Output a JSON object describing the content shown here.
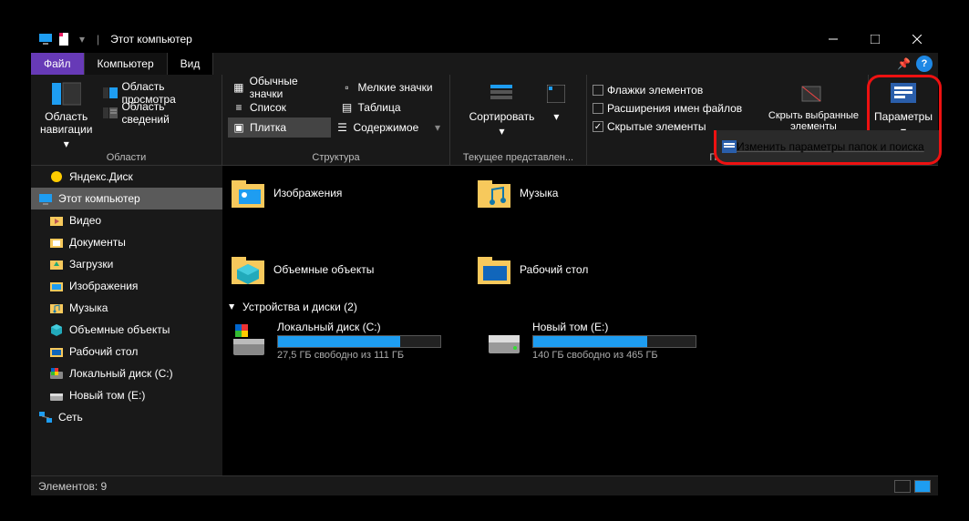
{
  "window": {
    "title": "Этот компьютер"
  },
  "tabs": {
    "file": "Файл",
    "computer": "Компьютер",
    "view": "Вид"
  },
  "ribbon": {
    "areas": {
      "nav": "Область\nнавигации",
      "preview": "Область просмотра",
      "details": "Область сведений",
      "label": "Области"
    },
    "layout": {
      "large": "Обычные значки",
      "small": "Мелкие значки",
      "list": "Список",
      "table": "Таблица",
      "tile": "Плитка",
      "content": "Содержимое",
      "label": "Структура"
    },
    "current": {
      "sort": "Сортировать",
      "label": "Текущее представлен..."
    },
    "show": {
      "cbx_flags": "Флажки элементов",
      "cbx_ext": "Расширения имен файлов",
      "cbx_hidden": "Скрытые элементы",
      "hide": "Скрыть выбранные\nэлементы",
      "label": "Показ..."
    },
    "options": {
      "btn": "Параметры",
      "popup": "Изменить параметры папок и поиска"
    }
  },
  "sidebar": {
    "items": [
      {
        "label": "Яндекс.Диск",
        "icon": "yadisk"
      },
      {
        "label": "Этот компьютер",
        "icon": "pc",
        "selected": true,
        "root": true
      },
      {
        "label": "Видео",
        "icon": "video"
      },
      {
        "label": "Документы",
        "icon": "docs"
      },
      {
        "label": "Загрузки",
        "icon": "downloads"
      },
      {
        "label": "Изображения",
        "icon": "pictures"
      },
      {
        "label": "Музыка",
        "icon": "music"
      },
      {
        "label": "Объемные объекты",
        "icon": "3d"
      },
      {
        "label": "Рабочий стол",
        "icon": "desktop"
      },
      {
        "label": "Локальный диск (C:)",
        "icon": "cdrive"
      },
      {
        "label": "Новый том (E:)",
        "icon": "drive"
      },
      {
        "label": "Сеть",
        "icon": "network",
        "root": true
      }
    ]
  },
  "content": {
    "folders": [
      {
        "label": "Изображения",
        "icon": "pictures"
      },
      {
        "label": "Музыка",
        "icon": "music"
      },
      {
        "label": "Объемные объекты",
        "icon": "3d"
      },
      {
        "label": "Рабочий стол",
        "icon": "desktop"
      }
    ],
    "group_header": "Устройства и диски (2)",
    "drives": [
      {
        "name": "Локальный диск (C:)",
        "free": "27,5 ГБ свободно из 111 ГБ",
        "fill_pct": 75,
        "icon": "cdrive"
      },
      {
        "name": "Новый том (E:)",
        "free": "140 ГБ свободно из 465 ГБ",
        "fill_pct": 70,
        "icon": "drive"
      }
    ]
  },
  "status": {
    "count": "Элементов: 9"
  }
}
